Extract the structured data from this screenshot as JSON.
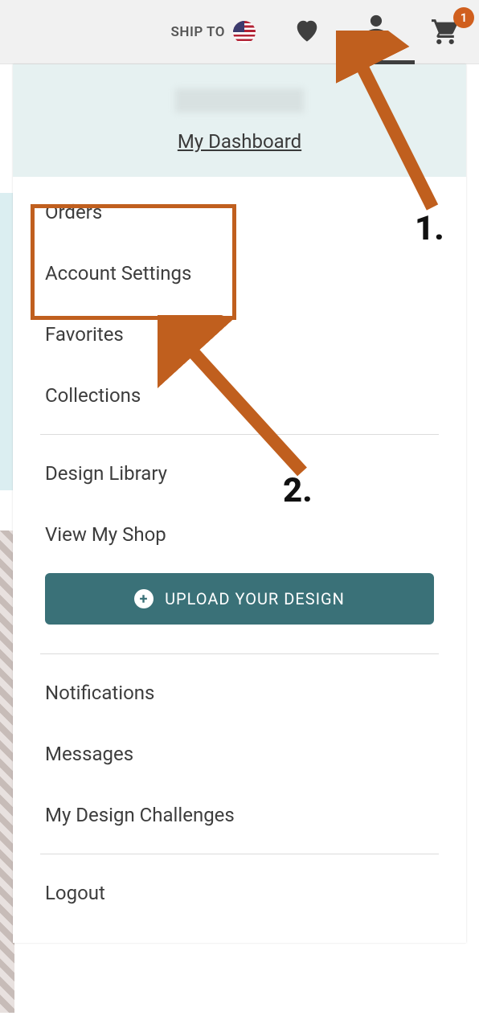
{
  "header": {
    "ship_to_label": "SHIP TO",
    "cart_count": "1"
  },
  "dropdown": {
    "dashboard_link": "My Dashboard",
    "section1": {
      "orders": "Orders",
      "account_settings": "Account Settings",
      "favorites": "Favorites",
      "collections": "Collections"
    },
    "section2": {
      "design_library": "Design Library",
      "view_my_shop": "View My Shop",
      "upload_btn": "UPLOAD YOUR DESIGN"
    },
    "section3": {
      "notifications": "Notifications",
      "messages": "Messages",
      "my_design_challenges": "My Design Challenges"
    },
    "section4": {
      "logout": "Logout"
    }
  },
  "annotation": {
    "label1": "1.",
    "label2": "2.",
    "arrow_color": "#c05f1e"
  }
}
